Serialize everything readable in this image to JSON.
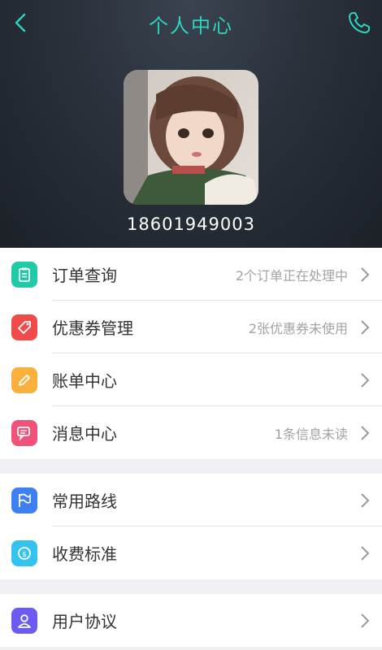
{
  "header": {
    "title": "个人中心",
    "phone_number": "18601949003",
    "accent": "#2fd3c0"
  },
  "groups": [
    {
      "items": [
        {
          "label": "订单查询",
          "status": "2个订单正在处理中",
          "icon": "clipboard-icon",
          "color": "#1fcaa6"
        },
        {
          "label": "优惠券管理",
          "status": "2张优惠券未使用",
          "icon": "tag-icon",
          "color": "#f04b4b"
        },
        {
          "label": "账单中心",
          "status": "",
          "icon": "pencil-icon",
          "color": "#f7b13c"
        },
        {
          "label": "消息中心",
          "status": "1条信息未读",
          "icon": "message-icon",
          "color": "#f0527a"
        }
      ]
    },
    {
      "items": [
        {
          "label": "常用路线",
          "status": "",
          "icon": "flag-icon",
          "color": "#3e7ff3"
        },
        {
          "label": "收费标准",
          "status": "",
          "icon": "coin-icon",
          "color": "#33c3ee"
        }
      ]
    },
    {
      "items": [
        {
          "label": "用户协议",
          "status": "",
          "icon": "user-icon",
          "color": "#6b5bf1"
        }
      ]
    }
  ]
}
